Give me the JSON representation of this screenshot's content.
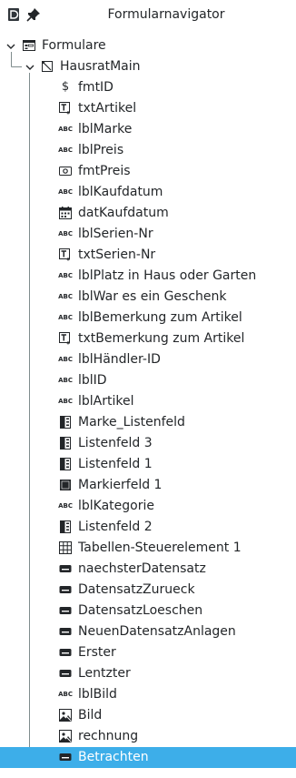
{
  "window": {
    "title": "Formularnavigator",
    "icons": [
      "document-icon",
      "pin-icon"
    ]
  },
  "tree": {
    "root": {
      "label": "Formulare",
      "icon": "forms-icon",
      "expanded": true
    },
    "form": {
      "label": "HausratMain",
      "icon": "form-icon",
      "expanded": true
    },
    "controls": [
      {
        "label": "fmtID",
        "icon": "formatted-field-icon"
      },
      {
        "label": "txtArtikel",
        "icon": "text-box-icon"
      },
      {
        "label": "lblMarke",
        "icon": "label-icon"
      },
      {
        "label": "lblPreis",
        "icon": "label-icon"
      },
      {
        "label": "fmtPreis",
        "icon": "currency-field-icon"
      },
      {
        "label": "lblKaufdatum",
        "icon": "label-icon"
      },
      {
        "label": "datKaufdatum",
        "icon": "date-field-icon"
      },
      {
        "label": "lblSerien-Nr",
        "icon": "label-icon"
      },
      {
        "label": "txtSerien-Nr",
        "icon": "text-box-icon"
      },
      {
        "label": "lblPlatz in Haus oder Garten",
        "icon": "label-icon"
      },
      {
        "label": "lblWar es ein Geschenk",
        "icon": "label-icon"
      },
      {
        "label": "lblBemerkung zum Artikel",
        "icon": "label-icon"
      },
      {
        "label": "txtBemerkung zum Artikel",
        "icon": "text-box-icon"
      },
      {
        "label": "lblHändler-ID",
        "icon": "label-icon"
      },
      {
        "label": "lblID",
        "icon": "label-icon"
      },
      {
        "label": "lblArtikel",
        "icon": "label-icon"
      },
      {
        "label": "Marke_Listenfeld",
        "icon": "list-box-icon"
      },
      {
        "label": "Listenfeld 3",
        "icon": "list-box-icon"
      },
      {
        "label": "Listenfeld 1",
        "icon": "list-box-icon"
      },
      {
        "label": "Markierfeld 1",
        "icon": "check-box-icon"
      },
      {
        "label": "lblKategorie",
        "icon": "label-icon"
      },
      {
        "label": "Listenfeld 2",
        "icon": "list-box-icon"
      },
      {
        "label": "Tabellen-Steuerelement  1",
        "icon": "table-control-icon"
      },
      {
        "label": "naechsterDatensatz",
        "icon": "push-button-icon"
      },
      {
        "label": "DatensatzZurueck",
        "icon": "push-button-icon"
      },
      {
        "label": "DatensatzLoeschen",
        "icon": "push-button-icon"
      },
      {
        "label": "NeuenDatensatzAnlagen",
        "icon": "push-button-icon"
      },
      {
        "label": "Erster",
        "icon": "push-button-icon"
      },
      {
        "label": "Lentzter",
        "icon": "push-button-icon"
      },
      {
        "label": "lblBild",
        "icon": "label-icon"
      },
      {
        "label": "Bild",
        "icon": "image-control-icon"
      },
      {
        "label": "rechnung",
        "icon": "image-control-icon"
      },
      {
        "label": "Betrachten",
        "icon": "push-button-icon",
        "selected": true
      }
    ]
  },
  "colors": {
    "selection": "#3daee9",
    "text": "#232629",
    "tree_lines": "#7f8c8d"
  }
}
